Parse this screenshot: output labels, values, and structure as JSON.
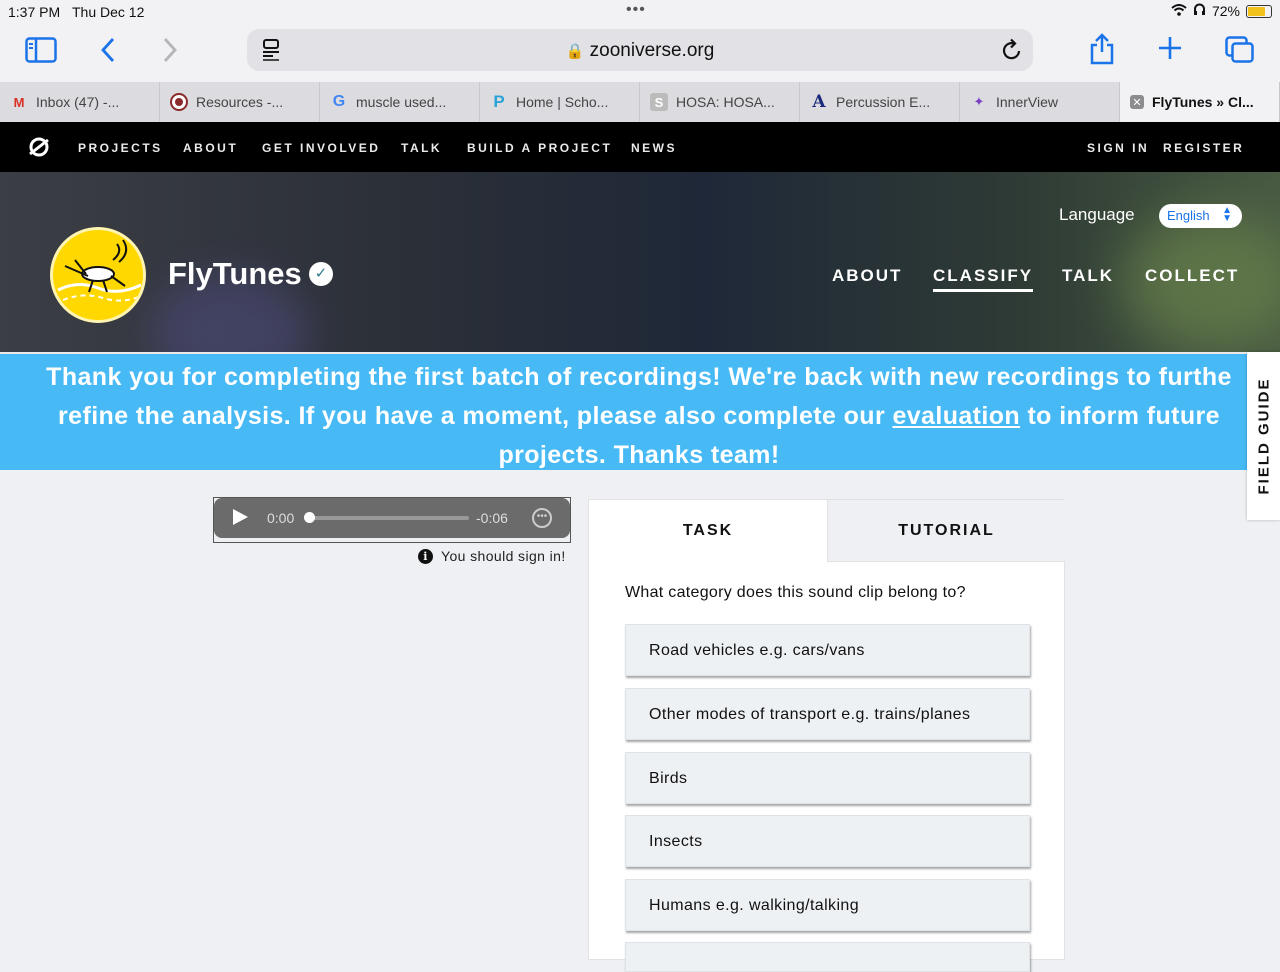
{
  "status_bar": {
    "time": "1:37 PM",
    "date": "Thu Dec 12",
    "battery": "72%"
  },
  "browser": {
    "url": "zooniverse.org",
    "tabs": [
      {
        "label": "Inbox (47) -...",
        "icon": "gmail-icon"
      },
      {
        "label": "Resources -...",
        "icon": "seal-icon"
      },
      {
        "label": "muscle used...",
        "icon": "google-icon"
      },
      {
        "label": "Home | Scho...",
        "icon": "p-icon"
      },
      {
        "label": "HOSA: HOSA...",
        "icon": "s-icon"
      },
      {
        "label": "Percussion E...",
        "icon": "a-icon"
      },
      {
        "label": "InnerView",
        "icon": "innerview-icon"
      },
      {
        "label": "FlyTunes » Cl...",
        "icon": "close-icon",
        "active": true
      }
    ]
  },
  "site_nav": {
    "items": [
      "PROJECTS",
      "ABOUT",
      "GET INVOLVED",
      "TALK",
      "BUILD A PROJECT",
      "NEWS"
    ],
    "sign_in": "SIGN IN",
    "register": "REGISTER"
  },
  "project": {
    "title": "FlyTunes",
    "language_label": "Language",
    "language_value": "English",
    "nav": [
      "ABOUT",
      "CLASSIFY",
      "TALK",
      "COLLECT"
    ],
    "active_nav": "CLASSIFY"
  },
  "banner": {
    "line1": "Thank you for completing the first batch of recordings! We're back with new recordings to furthe",
    "line2_pre": "refine the analysis. If you have a moment, please also complete our ",
    "link": "evaluation",
    "line2_post": " to inform future",
    "line3": "projects. Thanks team!"
  },
  "field_guide": "FIELD GUIDE",
  "audio": {
    "current": "0:00",
    "remaining": "-0:06",
    "progress": 0.0
  },
  "sign_in_note": "You should sign in!",
  "task": {
    "tab_task": "TASK",
    "tab_tutorial": "TUTORIAL",
    "question": "What category does this sound clip belong to?",
    "answers": [
      "Road vehicles e.g. cars/vans",
      "Other modes of transport e.g. trains/planes",
      "Birds",
      "Insects",
      "Humans e.g. walking/talking"
    ]
  }
}
